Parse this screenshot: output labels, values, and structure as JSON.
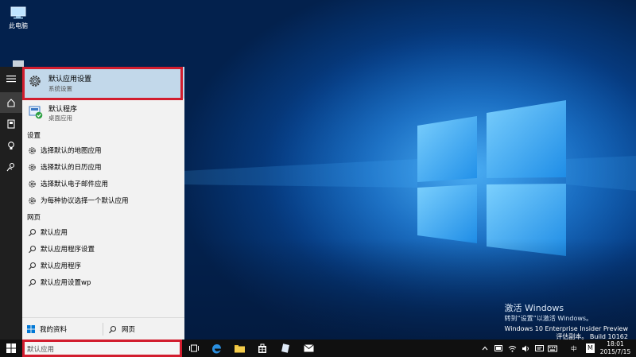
{
  "desktop": {
    "this_pc_label": "此电脑"
  },
  "watermark": {
    "title": "激活 Windows",
    "subtitle": "转到“设置”以激活 Windows。",
    "build_line1": "Windows 10 Enterprise Insider Preview",
    "build_line2": "评估副本。 Build 10162"
  },
  "start_menu": {
    "best_match": {
      "title": "默认应用设置",
      "subtitle": "系统设置",
      "icon": "gear-icon"
    },
    "second_match": {
      "title": "默认程序",
      "subtitle": "桌面应用",
      "icon": "default-programs-icon"
    },
    "settings_header": "设置",
    "settings_items": [
      {
        "label": "选择默认的地图应用",
        "icon": "gear-icon"
      },
      {
        "label": "选择默认的日历应用",
        "icon": "gear-icon"
      },
      {
        "label": "选择默认电子邮件应用",
        "icon": "gear-icon"
      },
      {
        "label": "为每种协议选择一个默认应用",
        "icon": "gear-icon"
      }
    ],
    "web_header": "网页",
    "web_items": [
      {
        "label": "默认应用",
        "icon": "search-icon"
      },
      {
        "label": "默认应用程序设置",
        "icon": "search-icon"
      },
      {
        "label": "默认应用程序",
        "icon": "search-icon"
      },
      {
        "label": "默认应用设置wp",
        "icon": "search-icon"
      }
    ],
    "bottom": {
      "my_stuff": "我的资料",
      "web": "网页"
    }
  },
  "taskbar": {
    "search_value": "默认应用",
    "ime_label": "中",
    "ime_mode": "M",
    "time": "18:01",
    "date": "2015/7/15"
  },
  "colors": {
    "accent_highlight": "#c2d8ea",
    "red_annotation": "#d21d2e",
    "taskbar": "#101010"
  }
}
